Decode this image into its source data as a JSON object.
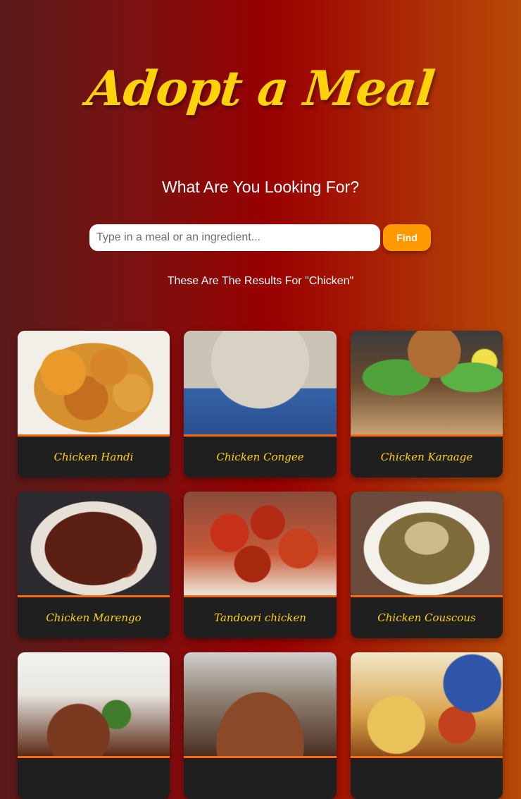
{
  "header": {
    "title": "Adopt a Meal",
    "prompt": "What Are You Looking For?"
  },
  "search": {
    "value": "",
    "placeholder": "Type in a meal or an ingredient...",
    "button_label": "Find"
  },
  "results": {
    "heading": "These Are The Results For \"Chicken\"",
    "meals": [
      {
        "name": "Chicken Handi",
        "image": "chicken-handi-photo"
      },
      {
        "name": "Chicken Congee",
        "image": "chicken-congee-photo"
      },
      {
        "name": "Chicken Karaage",
        "image": "chicken-karaage-photo"
      },
      {
        "name": "Chicken Marengo",
        "image": "chicken-marengo-photo"
      },
      {
        "name": "Tandoori chicken",
        "image": "tandoori-chicken-photo"
      },
      {
        "name": "Chicken Couscous",
        "image": "chicken-couscous-photo"
      },
      {
        "name": "",
        "image": "meal-photo-7"
      },
      {
        "name": "",
        "image": "meal-photo-8"
      },
      {
        "name": "",
        "image": "meal-photo-9"
      }
    ]
  },
  "colors": {
    "title": "#ffd20a",
    "accent": "#ff9900",
    "card_background": "#1f1f1f",
    "card_divider": "#ff6a00"
  }
}
